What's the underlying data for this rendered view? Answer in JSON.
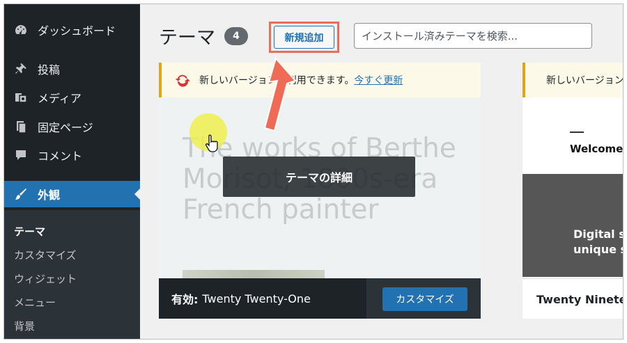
{
  "sidebar": {
    "items": [
      {
        "label": "ダッシュボード",
        "icon": "dashboard-icon"
      },
      {
        "label": "投稿",
        "icon": "pin-icon"
      },
      {
        "label": "メディア",
        "icon": "media-icon"
      },
      {
        "label": "固定ページ",
        "icon": "page-icon"
      },
      {
        "label": "コメント",
        "icon": "comment-icon"
      },
      {
        "label": "外観",
        "icon": "brush-icon"
      }
    ],
    "submenu": [
      "テーマ",
      "カスタマイズ",
      "ウィジェット",
      "メニュー",
      "背景"
    ]
  },
  "header": {
    "title": "テーマ",
    "count": "4",
    "add_new_label": "新規追加",
    "search_placeholder": "インストール済みテーマを検索..."
  },
  "card1": {
    "notice_text": "新しいバージョンが利用できます。",
    "notice_link": "今すぐ更新",
    "screenshot_text": "The works of Berthe Morisot, 1800s-era French painter",
    "overlay_label": "テーマの詳細",
    "active_prefix": "有効:",
    "theme_name": "Twenty Twenty-One",
    "customize_label": "カスタマイズ"
  },
  "card2": {
    "notice_text": "新しいバージョンが利用できます。",
    "welcome_text": "Welcome",
    "dark_text": "Digital st\nunique s",
    "theme_name": "Twenty Nineteen"
  },
  "colors": {
    "sidebar_bg": "#1d2327",
    "accent": "#2271b1",
    "highlight_box": "#e56f5b",
    "notice_border": "#dba617"
  }
}
